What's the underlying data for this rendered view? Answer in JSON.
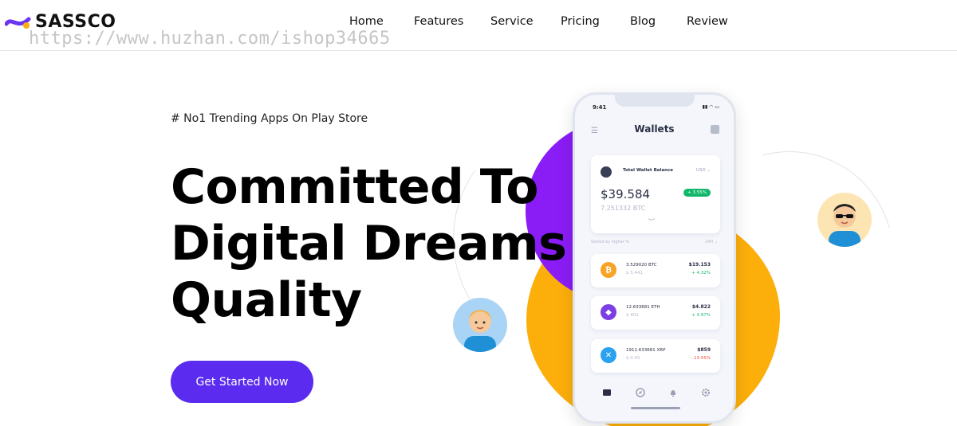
{
  "header": {
    "logo_text": "SASSCO",
    "watermark": "https://www.huzhan.com/ishop34665",
    "nav": [
      "Home",
      "Features",
      "Service",
      "Pricing",
      "Blog",
      "Review"
    ]
  },
  "hero": {
    "tag": "# No1 Trending Apps On Play Store",
    "title_lines": [
      "Committed To",
      "Digital Dreams",
      "Quality"
    ],
    "cta_label": "Get Started Now"
  },
  "phone": {
    "time": "9:41",
    "title": "Wallets",
    "balance": {
      "label": "Total Wallet Balance",
      "currency": "USD",
      "amount": "$39.584",
      "change": "+ 3.55%",
      "btc": "7.251332 BTC"
    },
    "sort_label": "Sorted by higher %",
    "sort_range": "24H",
    "coins": [
      {
        "amount": "3.529020 BTC",
        "price": "$ 5.441",
        "usd": "$19.153",
        "change": "+ 4.32%",
        "color": "#f7a325",
        "change_color": "#12b76a",
        "icon": "bitcoin-icon"
      },
      {
        "amount": "12.633681 ETH",
        "price": "$ 401",
        "usd": "$4.822",
        "change": "+ 3.97%",
        "color": "#7b3fe4",
        "change_color": "#12b76a",
        "icon": "ethereum-icon"
      },
      {
        "amount": "1911.633681 XRP",
        "price": "$ 0.45",
        "usd": "$859",
        "change": "- 13.55%",
        "color": "#2aa2f0",
        "change_color": "#f04438",
        "icon": "ripple-icon"
      }
    ]
  },
  "colors": {
    "accent": "#5b2bef",
    "purple_blob": "#8a1cf5",
    "yellow_blob": "#fcae0a"
  }
}
